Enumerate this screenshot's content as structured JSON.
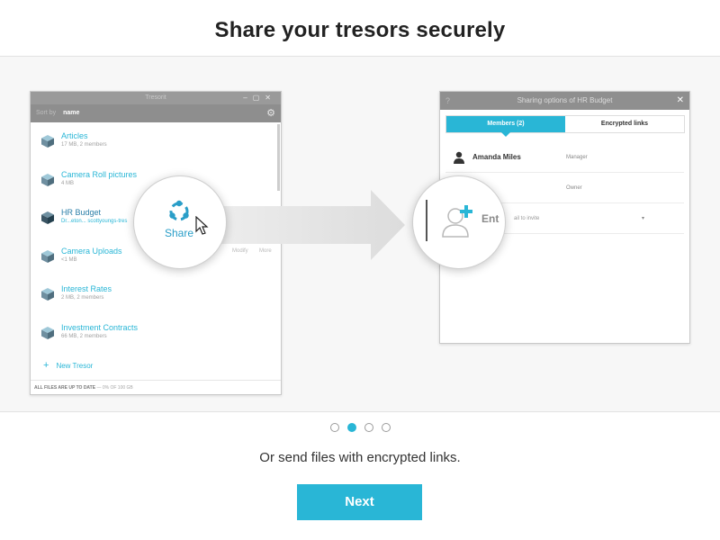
{
  "title": "Share your tresors securely",
  "left_window": {
    "title": "Tresorit",
    "sort_label": "Sort by",
    "sort_value": "name",
    "tresors": [
      {
        "name": "Articles",
        "meta": "17 MB, 2 members"
      },
      {
        "name": "Camera Roll pictures",
        "meta": "4 MB"
      },
      {
        "name": "HR Budget",
        "meta": "Dr...eton... scottyoungs-tres"
      },
      {
        "name": "Camera Uploads",
        "meta": "<1 MB"
      },
      {
        "name": "Interest Rates",
        "meta": "2 MB, 2 members"
      },
      {
        "name": "Investment Contracts",
        "meta": "66 MB, 2 members"
      }
    ],
    "new_tresor": "New Tresor",
    "footer_status": "ALL FILES ARE UP TO DATE",
    "footer_usage": "— 0% OF 100 GB",
    "ghost_actions": [
      "Modify",
      "More"
    ]
  },
  "share_label": "Share",
  "right_window": {
    "title": "Sharing options of HR Budget",
    "tabs": [
      "Members (2)",
      "Encrypted links"
    ],
    "members": [
      {
        "name": "Amanda Miles",
        "role": "Manager"
      },
      {
        "name": "",
        "role": "Owner"
      }
    ],
    "invite_placeholder": "ail to invite",
    "add_text": "Ent"
  },
  "pager": {
    "count": 4,
    "active": 1
  },
  "subtitle": "Or send files with encrypted links.",
  "next_label": "Next",
  "colors": {
    "accent": "#29b6d6",
    "titlebar": "#9a9a9a"
  }
}
